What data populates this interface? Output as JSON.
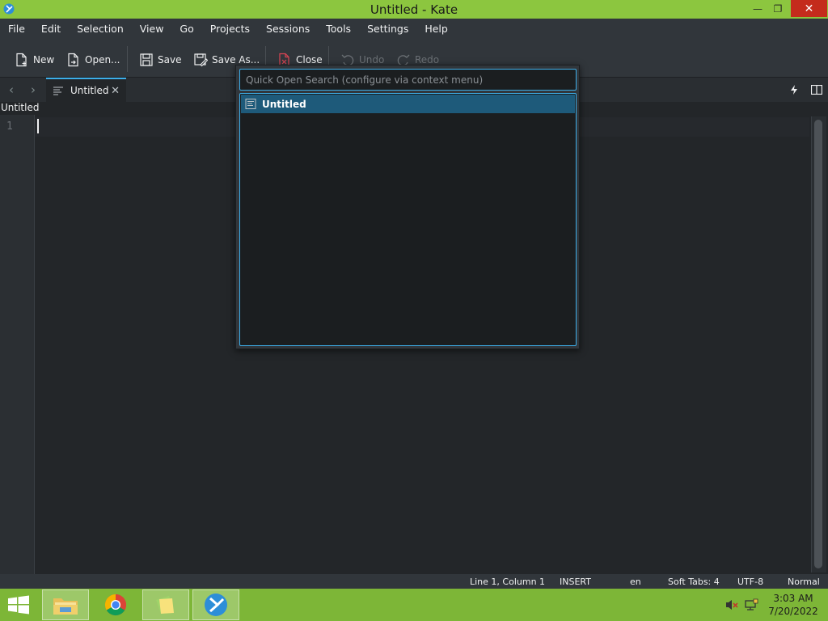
{
  "window": {
    "title": "Untitled  - Kate",
    "minimize_glyph": "—",
    "restore_glyph": "❐",
    "close_glyph": "✕"
  },
  "menu": [
    "File",
    "Edit",
    "Selection",
    "View",
    "Go",
    "Projects",
    "Sessions",
    "Tools",
    "Settings",
    "Help"
  ],
  "toolbar": {
    "new_label": "New",
    "open_label": "Open...",
    "save_label": "Save",
    "save_as_label": "Save As...",
    "close_label": "Close",
    "undo_label": "Undo",
    "redo_label": "Redo"
  },
  "tabs": {
    "prev_glyph": "‹",
    "next_glyph": "›",
    "active_label": "Untitled",
    "close_glyph": "✕"
  },
  "document": {
    "name": "Untitled",
    "line_number": "1"
  },
  "quick_open": {
    "placeholder": "Quick Open Search (configure via context menu)",
    "items": [
      "Untitled"
    ]
  },
  "status": {
    "position": "Line 1, Column 1",
    "mode": "INSERT",
    "language": "en",
    "indent": "Soft Tabs: 4",
    "encoding": "UTF-8",
    "input_mode": "Normal"
  },
  "taskbar": {
    "time": "3:03 AM",
    "date": "7/20/2022"
  },
  "colors": {
    "titlebar": "#8cc63f",
    "accent": "#3daee9",
    "editor_bg": "#232629",
    "taskbar": "#7db637"
  }
}
